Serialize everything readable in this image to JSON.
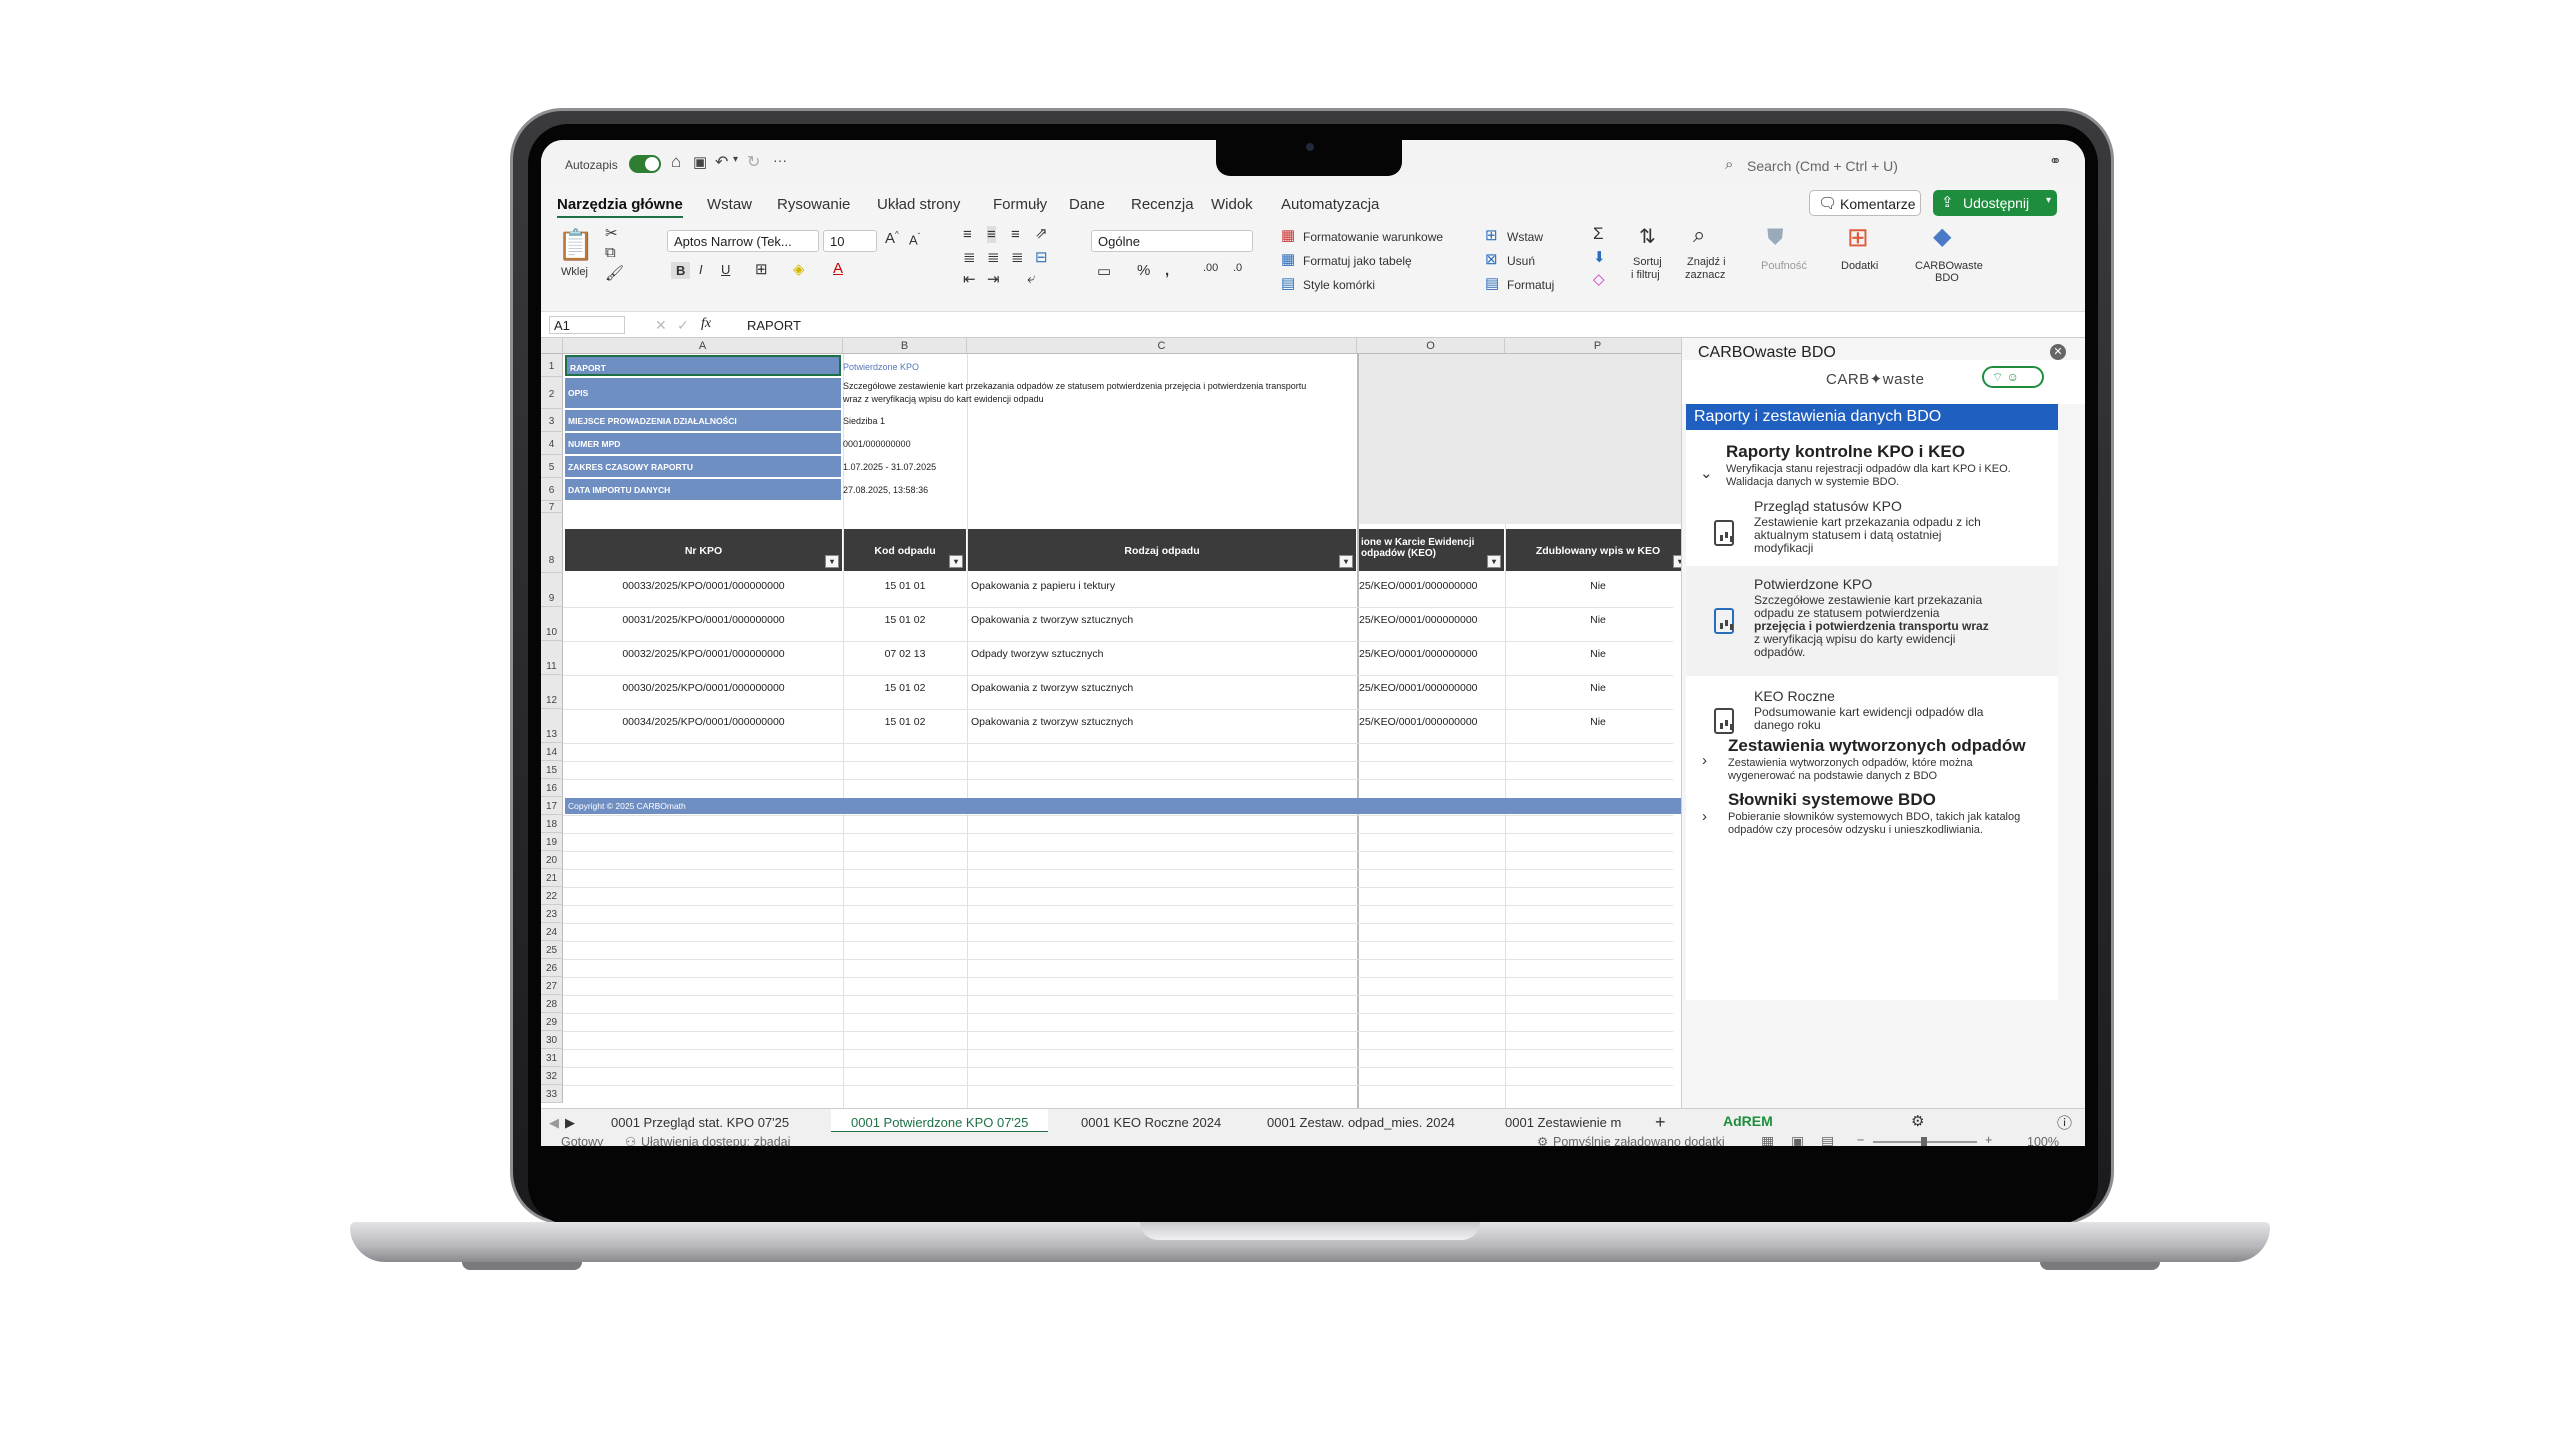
{
  "titlebar": {
    "autosave_label": "Autozapis",
    "more": "···",
    "search_placeholder": "Search (Cmd + Ctrl + U)"
  },
  "ribbon_tabs": [
    "Narzędzia główne",
    "Wstaw",
    "Rysowanie",
    "Układ strony",
    "Formuły",
    "Dane",
    "Recenzja",
    "Widok",
    "Automatyzacja"
  ],
  "actions": {
    "comments": "Komentarze",
    "share": "Udostępnij"
  },
  "ribbon": {
    "paste": "Wklej",
    "font_name": "Aptos Narrow (Tek...",
    "font_size": "10",
    "number_format": "Ogólne",
    "bold": "B",
    "italic": "I",
    "underline": "U",
    "percent": "%",
    "cond_format": "Formatowanie warunkowe",
    "format_table": "Formatuj jako tabelę",
    "cell_styles": "Style komórki",
    "insert": "Wstaw",
    "delete": "Usuń",
    "format": "Formatuj",
    "sort_1": "Sortuj",
    "sort_2": "i filtruj",
    "find_1": "Znajdź i",
    "find_2": "zaznacz",
    "sensitivity": "Poufność",
    "addins": "Dodatki",
    "carbo_1": "CARBOwaste",
    "carbo_2": "BDO"
  },
  "formula_bar": {
    "cell": "A1",
    "fx": "fx",
    "value": "RAPORT"
  },
  "columns": [
    {
      "label": "A"
    },
    {
      "label": "B"
    },
    {
      "label": "C"
    },
    {
      "label": "O"
    },
    {
      "label": "P"
    }
  ],
  "rows": [
    "1",
    "2",
    "3",
    "4",
    "5",
    "6",
    "7",
    "8",
    "9",
    "10",
    "11",
    "12",
    "13",
    "14",
    "15",
    "16",
    "17",
    "18",
    "19",
    "20",
    "21",
    "22",
    "23",
    "24",
    "25",
    "26",
    "27",
    "28",
    "29",
    "30",
    "31",
    "32",
    "33"
  ],
  "info": {
    "raport_label": "RAPORT",
    "raport_value": "Potwierdzone KPO",
    "opis_label": "OPIS",
    "opis_value_1": "Szczegółowe zestawienie kart przekazania odpadów ze statusem potwierdzenia przejęcia i potwierdzenia transportu",
    "opis_value_2": "wraz z weryfikacją wpisu do kart ewidencji odpadu",
    "miejsce_label": "MIEJSCE PROWADZENIA DZIAŁALNOŚCI",
    "miejsce_value": "Siedziba 1",
    "mpd_label": "NUMER MPD",
    "mpd_value": "0001/000000000",
    "zakres_label": "ZAKRES CZASOWY RAPORTU",
    "zakres_value": "1.07.2025 - 31.07.2025",
    "data_label": "DATA IMPORTU DANYCH",
    "data_value": "27.08.2025, 13:58:36"
  },
  "table": {
    "headers": {
      "nr": "Nr KPO",
      "kod": "Kod odpadu",
      "rodzaj": "Rodzaj odpadu",
      "keo_1": "ione w Karcie Ewidencji",
      "keo_2": "odpadów (KEO)",
      "dup": "Zdublowany wpis w KEO"
    },
    "rows": [
      {
        "nr": "00033/2025/KPO/0001/000000000",
        "kod": "15 01 01",
        "rodzaj": "Opakowania z papieru i tektury",
        "keo": "25/KEO/0001/000000000",
        "dup": "Nie"
      },
      {
        "nr": "00031/2025/KPO/0001/000000000",
        "kod": "15 01 02",
        "rodzaj": "Opakowania z tworzyw sztucznych",
        "keo": "25/KEO/0001/000000000",
        "dup": "Nie"
      },
      {
        "nr": "00032/2025/KPO/0001/000000000",
        "kod": "07 02 13",
        "rodzaj": "Odpady tworzyw sztucznych",
        "keo": "25/KEO/0001/000000000",
        "dup": "Nie"
      },
      {
        "nr": "00030/2025/KPO/0001/000000000",
        "kod": "15 01 02",
        "rodzaj": "Opakowania z tworzyw sztucznych",
        "keo": "25/KEO/0001/000000000",
        "dup": "Nie"
      },
      {
        "nr": "00034/2025/KPO/0001/000000000",
        "kod": "15 01 02",
        "rodzaj": "Opakowania z tworzyw sztucznych",
        "keo": "25/KEO/0001/000000000",
        "dup": "Nie"
      }
    ],
    "copyright": "Copyright © 2025 CARBOmath"
  },
  "sheet_tabs": [
    "0001 Przegląd stat. KPO 07'25",
    "0001 Potwierdzone KPO 07'25",
    "0001 KEO Roczne 2024",
    "0001 Zestaw. odpad_mies. 2024",
    "0001 Zestawienie m"
  ],
  "statusbar": {
    "ready": "Gotowy",
    "accessibility": "Ułatwienia dostępu: zbadaj",
    "addins_loaded": "Pomyślnie załadowano dodatki",
    "zoom": "100%"
  },
  "pane": {
    "title": "CARBOwaste BDO",
    "brand": "CARB✦waste",
    "banner": "Raporty i zestawienia danych BDO",
    "group1_title": "Raporty kontrolne KPO i KEO",
    "group1_desc_1": "Weryfikacja stanu rejestracji odpadów dla kart KPO i KEO.",
    "group1_desc_2": "Walidacja danych w systemie BDO.",
    "item1_title": "Przegląd statusów KPO",
    "item1_d1": "Zestawienie kart przekazania odpadu z ich",
    "item1_d2": "aktualnym statusem i datą ostatniej",
    "item1_d3": "modyfikacji",
    "item2_title": "Potwierdzone KPO",
    "item2_d1": "Szczegółowe zestawienie kart przekazania",
    "item2_d2": "odpadu ze statusem potwierdzenia",
    "item2_d3": "przejęcia i potwierdzenia transportu wraz",
    "item2_d4": "z weryfikacją wpisu do karty ewidencji",
    "item2_d5": "odpadów.",
    "item3_title": "KEO Roczne",
    "item3_d1": "Podsumowanie kart ewidencji odpadów dla",
    "item3_d2": "danego roku",
    "group2_title": "Zestawienia wytworzonych odpadów",
    "group2_d1": "Zestawienia wytworzonych odpadów, które można",
    "group2_d2": "wygenerować na podstawie danych z BDO",
    "group3_title": "Słowniki systemowe BDO",
    "group3_d1": "Pobieranie słowników systemowych BDO, takich jak katalog",
    "group3_d2": "odpadów czy procesów odzysku i unieszkodliwiania.",
    "footer_logo": "AdREM"
  }
}
